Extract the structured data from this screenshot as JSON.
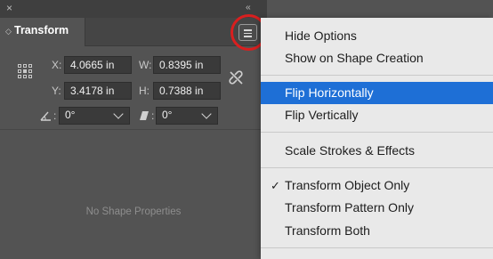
{
  "window": {
    "close_glyph": "×",
    "collapse_glyph": "‹‹"
  },
  "panel": {
    "tab_title": "Transform",
    "x_label": "X:",
    "x_value": "4.0665 in",
    "y_label": "Y:",
    "y_value": "3.4178 in",
    "w_label": "W:",
    "w_value": "0.8395 in",
    "h_label": "H:",
    "h_value": "0.7388 in",
    "rotate_label": ":",
    "rotate_value": "0°",
    "shear_label": ":",
    "shear_value": "0°",
    "empty_message": "No Shape Properties"
  },
  "menu": {
    "items": [
      {
        "label": "Hide Options"
      },
      {
        "label": "Show on Shape Creation"
      },
      {
        "label": "Flip Horizontally",
        "highlighted": true
      },
      {
        "label": "Flip Vertically"
      },
      {
        "label": "Scale Strokes & Effects"
      },
      {
        "label": "Transform Object Only",
        "checked": true
      },
      {
        "label": "Transform Pattern Only"
      },
      {
        "label": "Transform Both"
      }
    ],
    "check_glyph": "✓"
  },
  "colors": {
    "panel_bg": "#535353",
    "menu_bg": "#e9e9e9",
    "highlight": "#1e6fd6",
    "callout_ring": "#d91f1f"
  },
  "icons": [
    "close-icon",
    "collapse-icon",
    "panel-menu-icon",
    "reference-point-icon",
    "constrain-proportions-link-icon",
    "rotate-angle-icon",
    "shear-angle-icon",
    "chevron-down-icon",
    "checkmark-icon"
  ]
}
